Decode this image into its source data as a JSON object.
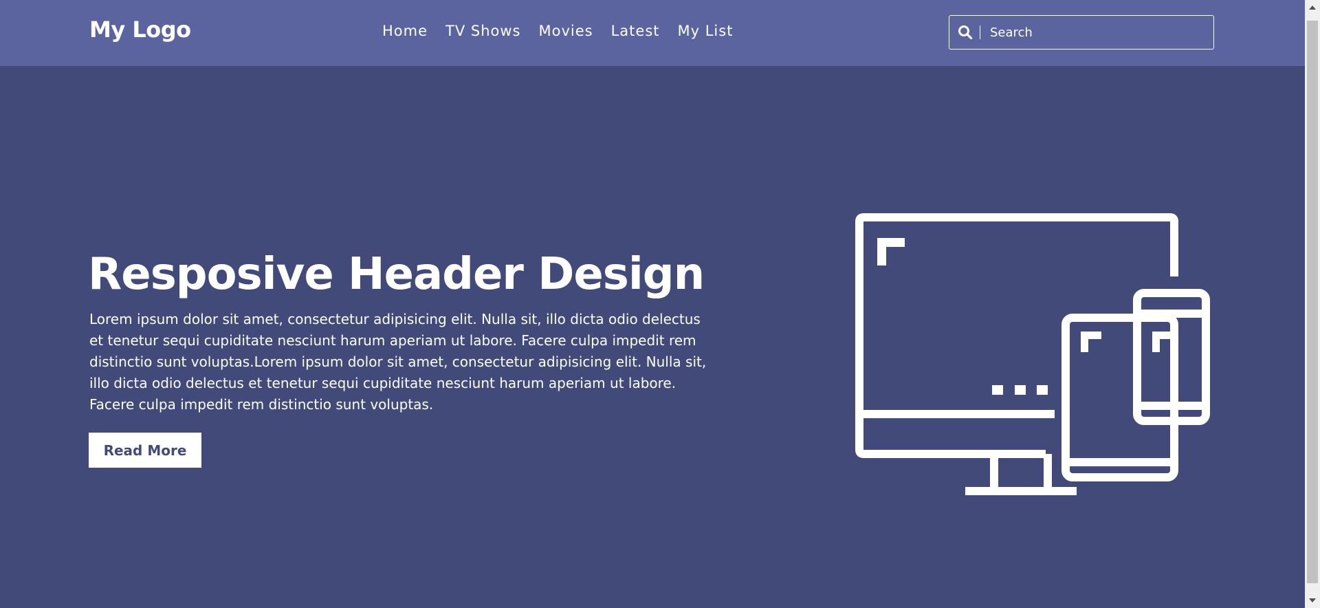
{
  "header": {
    "logo": "My Logo",
    "nav": [
      "Home",
      "TV Shows",
      "Movies",
      "Latest",
      "My List"
    ],
    "search": {
      "placeholder": "Search",
      "value": "",
      "icon": "search-icon"
    }
  },
  "hero": {
    "title": "Resposive Header Design",
    "text": "Lorem ipsum dolor sit amet, consectetur adipisicing elit. Nulla sit, illo dicta odio delectus et tenetur sequi cupiditate nesciunt harum aperiam ut labore. Facere culpa impedit rem distinctio sunt voluptas.Lorem ipsum dolor sit amet, consectetur adipisicing elit. Nulla sit, illo dicta odio delectus et tenetur sequi cupiditate nesciunt harum aperiam ut labore. Facere culpa impedit rem distinctio sunt voluptas.",
    "button": "Read More",
    "illustration": "responsive-devices-icon"
  },
  "colors": {
    "header_bg": "#5b649e",
    "page_bg": "#424a79",
    "text": "#ffffff",
    "button_text": "#424a79"
  }
}
